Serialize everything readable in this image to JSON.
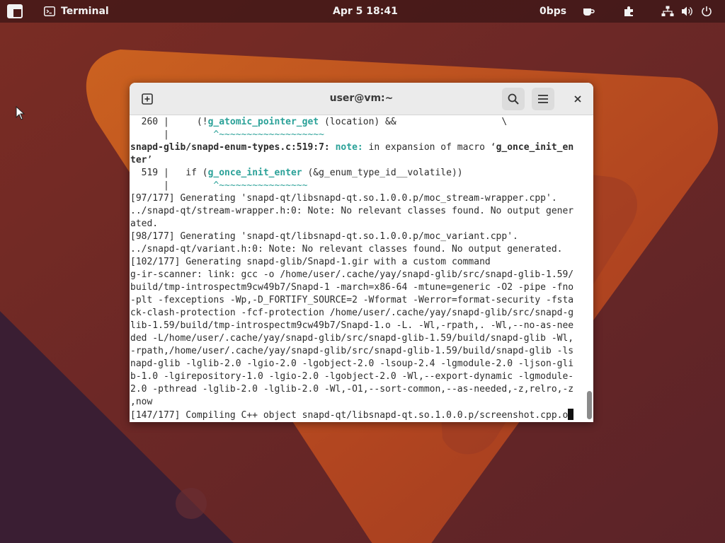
{
  "topbar": {
    "app_label": "Terminal",
    "clock": "Apr 5  18:41",
    "net_speed": "0bps",
    "icons": [
      "activities-icon",
      "terminal-app-icon",
      "coffee-icon",
      "extensions-icon",
      "network-icon",
      "volume-icon",
      "power-icon"
    ]
  },
  "window": {
    "title": "user@vm:~",
    "icons": [
      "new-tab-icon",
      "search-icon",
      "hamburger-menu-icon",
      "close-icon"
    ]
  },
  "terminal": {
    "lines": [
      [
        {
          "t": "  260 |     (!"
        },
        {
          "t": "g_atomic_pointer_get",
          "c": "cyan"
        },
        {
          "t": " (location) &&                   \\"
        }
      ],
      [
        {
          "t": "      |        "
        },
        {
          "t": "^~~~~~~~~~~~~~~~~~~~",
          "c": "tilde"
        }
      ],
      [
        {
          "t": "snapd-glib/snapd-enum-types.c:519:7: ",
          "c": "bold"
        },
        {
          "t": "note:",
          "c": "cyan"
        },
        {
          "t": " in expansion of macro ‘"
        },
        {
          "t": "g_once_init_en",
          "c": "bold"
        }
      ],
      [
        {
          "t": "ter",
          "c": "bold"
        },
        {
          "t": "’"
        }
      ],
      [
        {
          "t": "  519 |   if ("
        },
        {
          "t": "g_once_init_enter",
          "c": "cyan"
        },
        {
          "t": " (&g_enum_type_id__volatile))"
        }
      ],
      [
        {
          "t": "      |        "
        },
        {
          "t": "^~~~~~~~~~~~~~~~~",
          "c": "tilde"
        }
      ],
      [
        {
          "t": "[97/177] Generating 'snapd-qt/libsnapd-qt.so.1.0.0.p/moc_stream-wrapper.cpp'."
        }
      ],
      [
        {
          "t": "../snapd-qt/stream-wrapper.h:0: Note: No relevant classes found. No output gener"
        }
      ],
      [
        {
          "t": "ated."
        }
      ],
      [
        {
          "t": "[98/177] Generating 'snapd-qt/libsnapd-qt.so.1.0.0.p/moc_variant.cpp'."
        }
      ],
      [
        {
          "t": "../snapd-qt/variant.h:0: Note: No relevant classes found. No output generated."
        }
      ],
      [
        {
          "t": "[102/177] Generating snapd-glib/Snapd-1.gir with a custom command"
        }
      ],
      [
        {
          "t": "g-ir-scanner: link: gcc -o /home/user/.cache/yay/snapd-glib/src/snapd-glib-1.59/"
        }
      ],
      [
        {
          "t": "build/tmp-introspectm9cw49b7/Snapd-1 -march=x86-64 -mtune=generic -O2 -pipe -fno"
        }
      ],
      [
        {
          "t": "-plt -fexceptions -Wp,-D_FORTIFY_SOURCE=2 -Wformat -Werror=format-security -fsta"
        }
      ],
      [
        {
          "t": "ck-clash-protection -fcf-protection /home/user/.cache/yay/snapd-glib/src/snapd-g"
        }
      ],
      [
        {
          "t": "lib-1.59/build/tmp-introspectm9cw49b7/Snapd-1.o -L. -Wl,-rpath,. -Wl,--no-as-nee"
        }
      ],
      [
        {
          "t": "ded -L/home/user/.cache/yay/snapd-glib/src/snapd-glib-1.59/build/snapd-glib -Wl,"
        }
      ],
      [
        {
          "t": "-rpath,/home/user/.cache/yay/snapd-glib/src/snapd-glib-1.59/build/snapd-glib -ls"
        }
      ],
      [
        {
          "t": "napd-glib -lglib-2.0 -lgio-2.0 -lgobject-2.0 -lsoup-2.4 -lgmodule-2.0 -ljson-gli"
        }
      ],
      [
        {
          "t": "b-1.0 -lgirepository-1.0 -lgio-2.0 -lgobject-2.0 -Wl,--export-dynamic -lgmodule-"
        }
      ],
      [
        {
          "t": "2.0 -pthread -lglib-2.0 -lglib-2.0 -Wl,-O1,--sort-common,--as-needed,-z,relro,-z"
        }
      ],
      [
        {
          "t": ",now"
        }
      ],
      [
        {
          "t": "[147/177] Compiling C++ object snapd-qt/libsnapd-qt.so.1.0.0.p/screenshot.cpp.o"
        }
      ]
    ]
  },
  "colors": {
    "accent_cyan": "#2aa198",
    "desktop_dark": "#5a2424",
    "desktop_orange": "#c85a1e",
    "desktop_left_dark": "#3d1f33"
  }
}
